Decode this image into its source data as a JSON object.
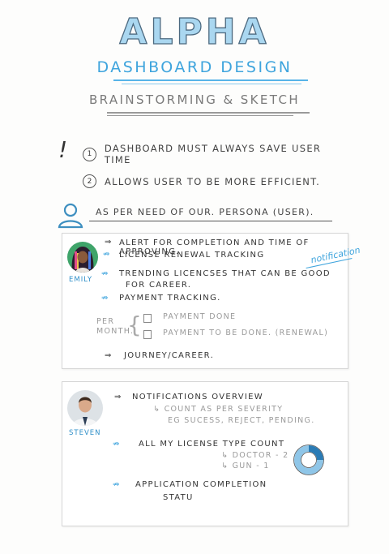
{
  "header": {
    "title": "ALPHA",
    "subtitle": "DASHBOARD DESIGN",
    "caption": "BRAINSTORMING & SKETCH"
  },
  "principles": {
    "mark": "!",
    "items": [
      {
        "num": "1",
        "text": "DASHBOARD MUST ALWAYS SAVE USER TIME"
      },
      {
        "num": "2",
        "text": "ALLOWS USER TO BE MORE EFFICIENT."
      }
    ]
  },
  "persona_intro": {
    "icon": "user-icon",
    "text": "AS PER NEED OF OUR. PERSONA (USER)."
  },
  "personas": [
    {
      "name": "EMILY",
      "items": [
        "ALERT FOR COMPLETION AND TIME OF APPROVING.",
        "LICENSE RENEWAL TRACKING",
        "TRENDING LICENCSES THAT CAN BE GOOD",
        "FOR CAREER.",
        "PAYMENT TRACKING.",
        "JOURNEY/CAREER."
      ],
      "annotation": "notification",
      "per_month": {
        "label_1": "PER",
        "label_2": "MONTH.",
        "options": [
          "PAYMENT DONE",
          "PAYMENT TO BE DONE. (RENEWAL)"
        ]
      }
    },
    {
      "name": "STEVEN",
      "items": [
        "NOTIFICATIONS OVERVIEW",
        "ALL MY LICENSE TYPE COUNT",
        "APPLICATION COMPLETION",
        "STATU"
      ],
      "sub_items": [
        "COUNT AS PER SEVERITY",
        "EG SUCESS, REJECT, PENDING.",
        "DOCTOR - 2",
        "GUN - 1"
      ]
    }
  ],
  "colors": {
    "accent": "#3ea4dd",
    "title_fill": "#aad7f0",
    "ink": "#3a3a3a",
    "muted": "#9a9a9a"
  }
}
